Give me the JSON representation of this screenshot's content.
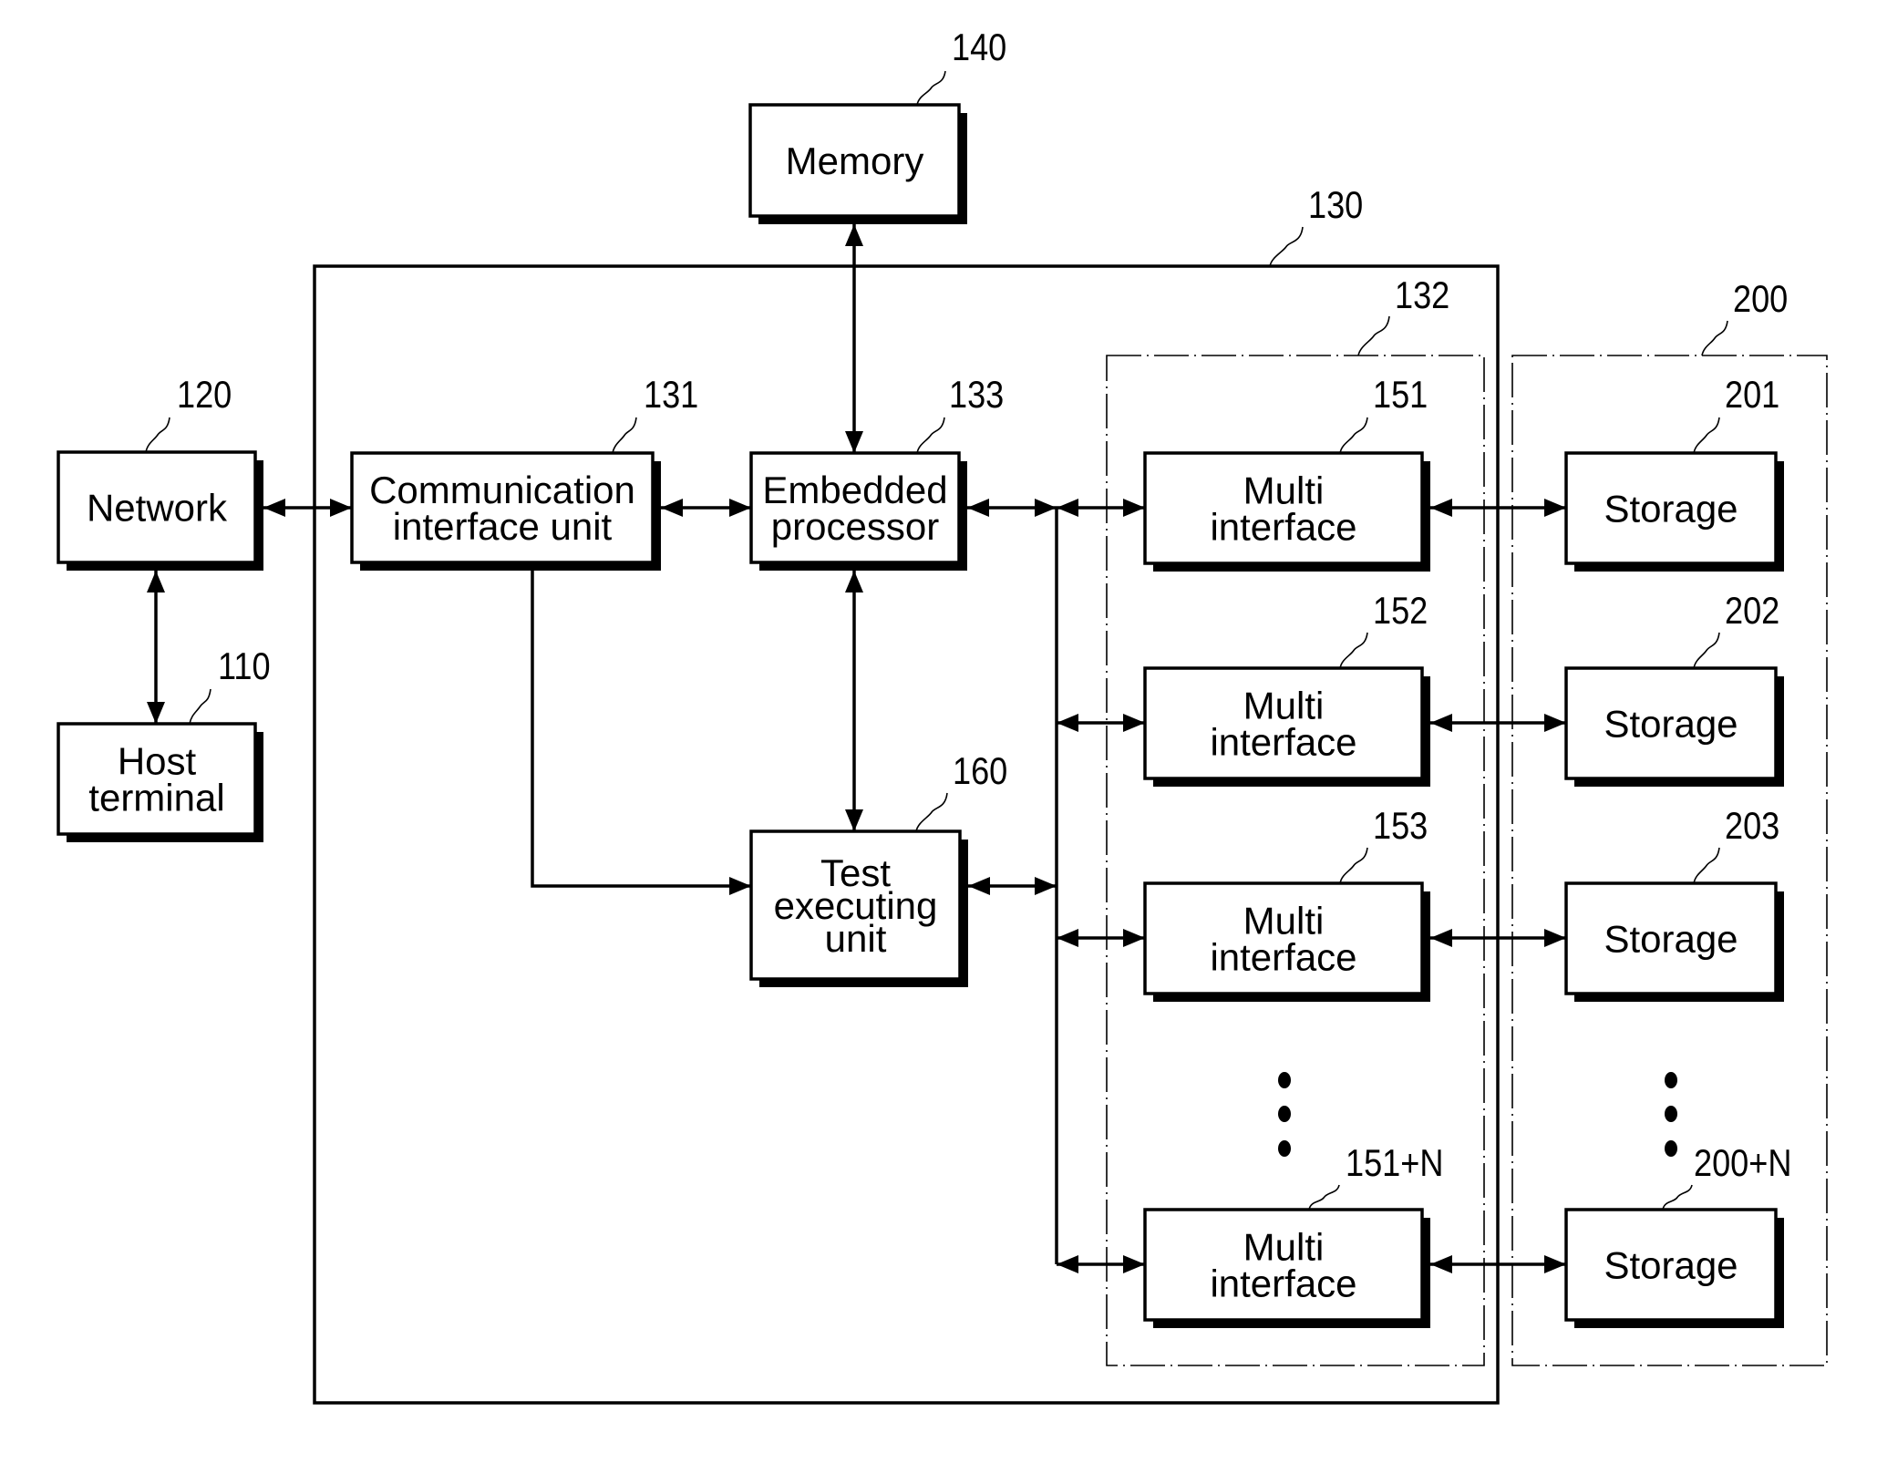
{
  "figure": {
    "type": "block-diagram",
    "blocks": {
      "memory": {
        "ref": "140",
        "lines": [
          "Memory"
        ]
      },
      "network": {
        "ref": "120",
        "lines": [
          "Network"
        ]
      },
      "host": {
        "ref": "110",
        "lines": [
          "Host",
          "terminal"
        ]
      },
      "comm": {
        "ref": "131",
        "lines": [
          "Communication",
          "interface unit"
        ]
      },
      "embedded": {
        "ref": "133",
        "lines": [
          "Embedded",
          "processor"
        ]
      },
      "test": {
        "ref": "160",
        "lines": [
          "Test",
          "executing",
          "unit"
        ]
      },
      "multi_1": {
        "ref": "151",
        "lines": [
          "Multi",
          "interface"
        ]
      },
      "multi_2": {
        "ref": "152",
        "lines": [
          "Multi",
          "interface"
        ]
      },
      "multi_3": {
        "ref": "153",
        "lines": [
          "Multi",
          "interface"
        ]
      },
      "multi_n": {
        "ref": "151+N",
        "lines": [
          "Multi",
          "interface"
        ]
      },
      "storage_1": {
        "ref": "201",
        "lines": [
          "Storage"
        ]
      },
      "storage_2": {
        "ref": "202",
        "lines": [
          "Storage"
        ]
      },
      "storage_3": {
        "ref": "203",
        "lines": [
          "Storage"
        ]
      },
      "storage_n": {
        "ref": "200+N",
        "lines": [
          "Storage"
        ]
      }
    },
    "groups": {
      "device": {
        "ref": "130"
      },
      "multi_group": {
        "ref": "132"
      },
      "storage_group": {
        "ref": "200"
      }
    },
    "connections": [
      [
        "network",
        "comm",
        "bidirectional"
      ],
      [
        "network",
        "host",
        "bidirectional"
      ],
      [
        "comm",
        "embedded",
        "bidirectional"
      ],
      [
        "embedded",
        "memory",
        "bidirectional"
      ],
      [
        "embedded",
        "test",
        "bidirectional"
      ],
      [
        "comm",
        "test",
        "unidirectional"
      ],
      [
        "embedded",
        "bus",
        "bidirectional"
      ],
      [
        "test",
        "bus",
        "bidirectional"
      ],
      [
        "bus",
        "multi_1",
        "bidirectional"
      ],
      [
        "bus",
        "multi_2",
        "bidirectional"
      ],
      [
        "bus",
        "multi_3",
        "bidirectional"
      ],
      [
        "bus",
        "multi_n",
        "bidirectional"
      ],
      [
        "multi_1",
        "storage_1",
        "bidirectional"
      ],
      [
        "multi_2",
        "storage_2",
        "bidirectional"
      ],
      [
        "multi_3",
        "storage_3",
        "bidirectional"
      ],
      [
        "multi_n",
        "storage_n",
        "bidirectional"
      ]
    ],
    "ellipsis": "⋮"
  }
}
